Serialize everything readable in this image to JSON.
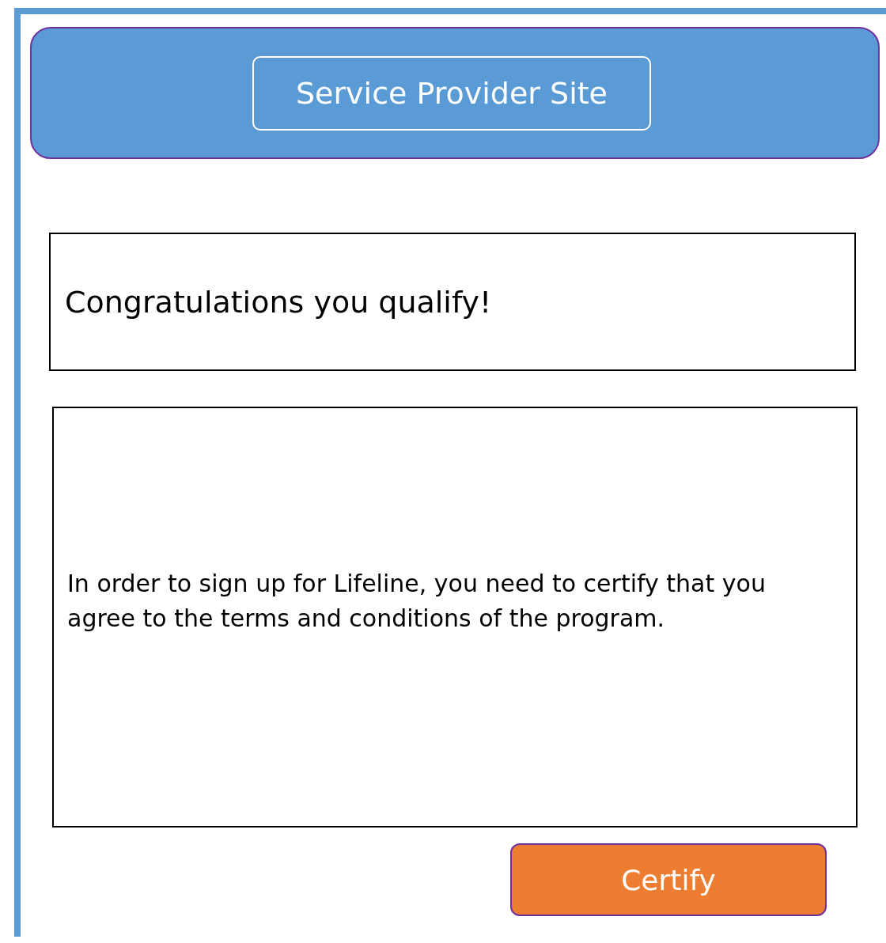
{
  "header": {
    "title": "Service Provider Site"
  },
  "message": "Congratulations you qualify!",
  "notice": "In order to sign up for Lifeline, you need to certify that you agree to the terms and conditions of the program.",
  "buttons": [
    {
      "label": "Certify",
      "kind": "primary"
    }
  ]
}
